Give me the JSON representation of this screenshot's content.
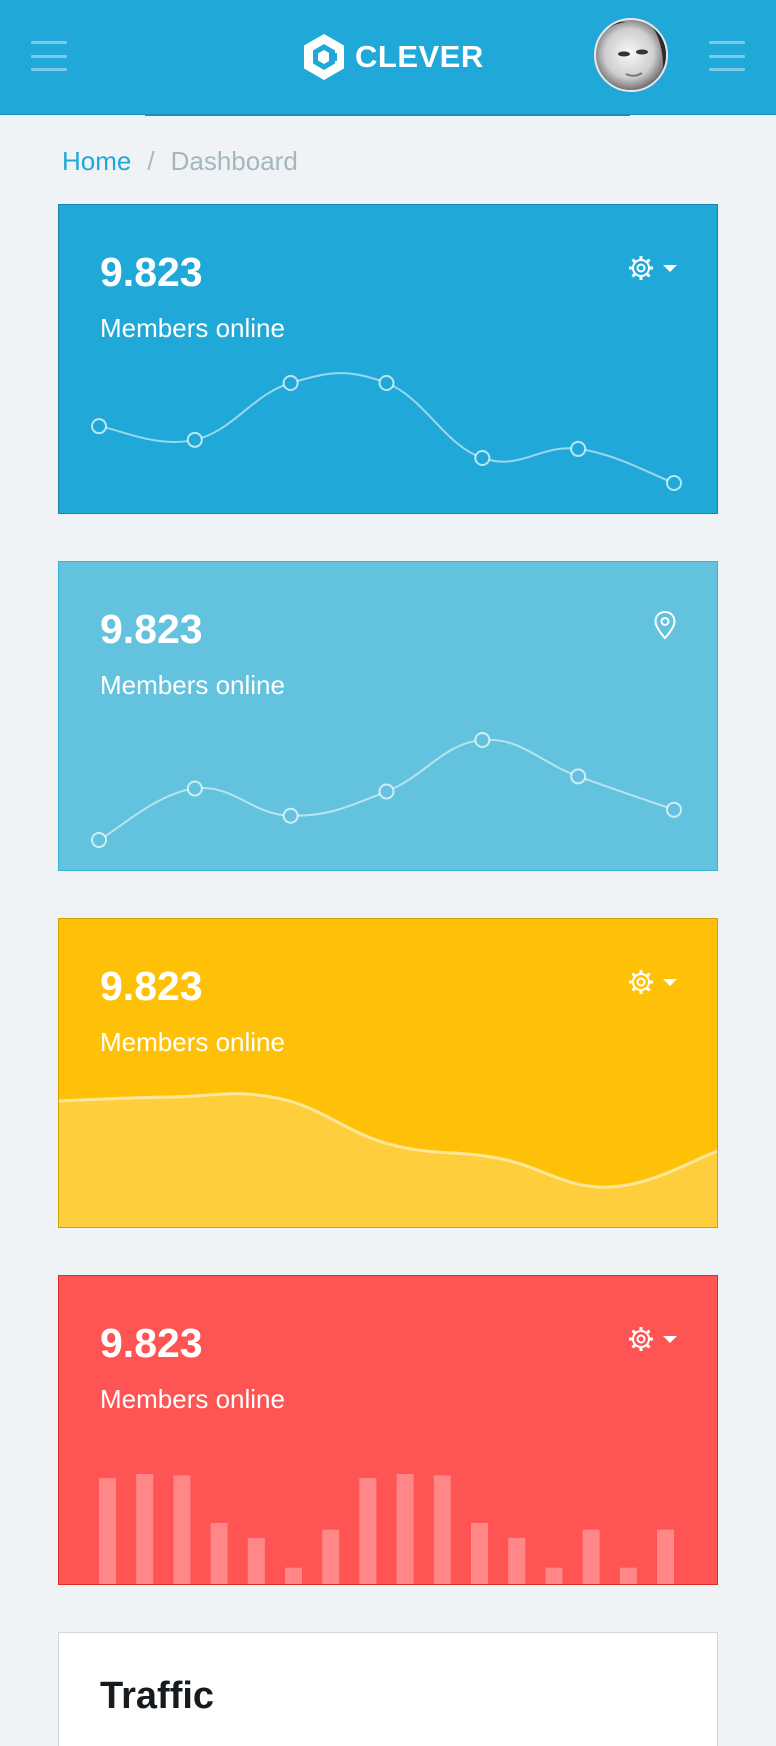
{
  "brand": {
    "name": "CLEVER",
    "logo_icon": "hexagon-c-logo",
    "color": "#20a8d8"
  },
  "header": {
    "left_menu_icon": "hamburger-icon",
    "right_menu_icon": "hamburger-icon",
    "avatar_icon": "user-avatar"
  },
  "breadcrumb": {
    "home": "Home",
    "separator": "/",
    "current": "Dashboard"
  },
  "cards": [
    {
      "value": "9.823",
      "label": "Members online",
      "action_icon": "gear-icon",
      "color": "#20a8d8",
      "chart_type": "line",
      "chart_values": [
        65,
        59,
        84,
        84,
        51,
        55,
        40
      ]
    },
    {
      "value": "9.823",
      "label": "Members online",
      "action_icon": "location-pin-icon",
      "color": "#63c2de",
      "chart_type": "line",
      "chart_values": [
        1,
        18,
        9,
        17,
        34,
        22,
        11
      ]
    },
    {
      "value": "9.823",
      "label": "Members online",
      "action_icon": "gear-icon",
      "color": "#ffc107",
      "chart_type": "area",
      "chart_values": [
        78,
        81,
        80,
        45,
        34,
        12,
        40
      ]
    },
    {
      "value": "9.823",
      "label": "Members online",
      "action_icon": "gear-icon",
      "color": "#ff5454",
      "chart_type": "bar",
      "chart_values": [
        78,
        81,
        80,
        45,
        34,
        12,
        40,
        78,
        81,
        80,
        45,
        34,
        12,
        40,
        12,
        40
      ]
    }
  ],
  "traffic": {
    "title": "Traffic"
  }
}
